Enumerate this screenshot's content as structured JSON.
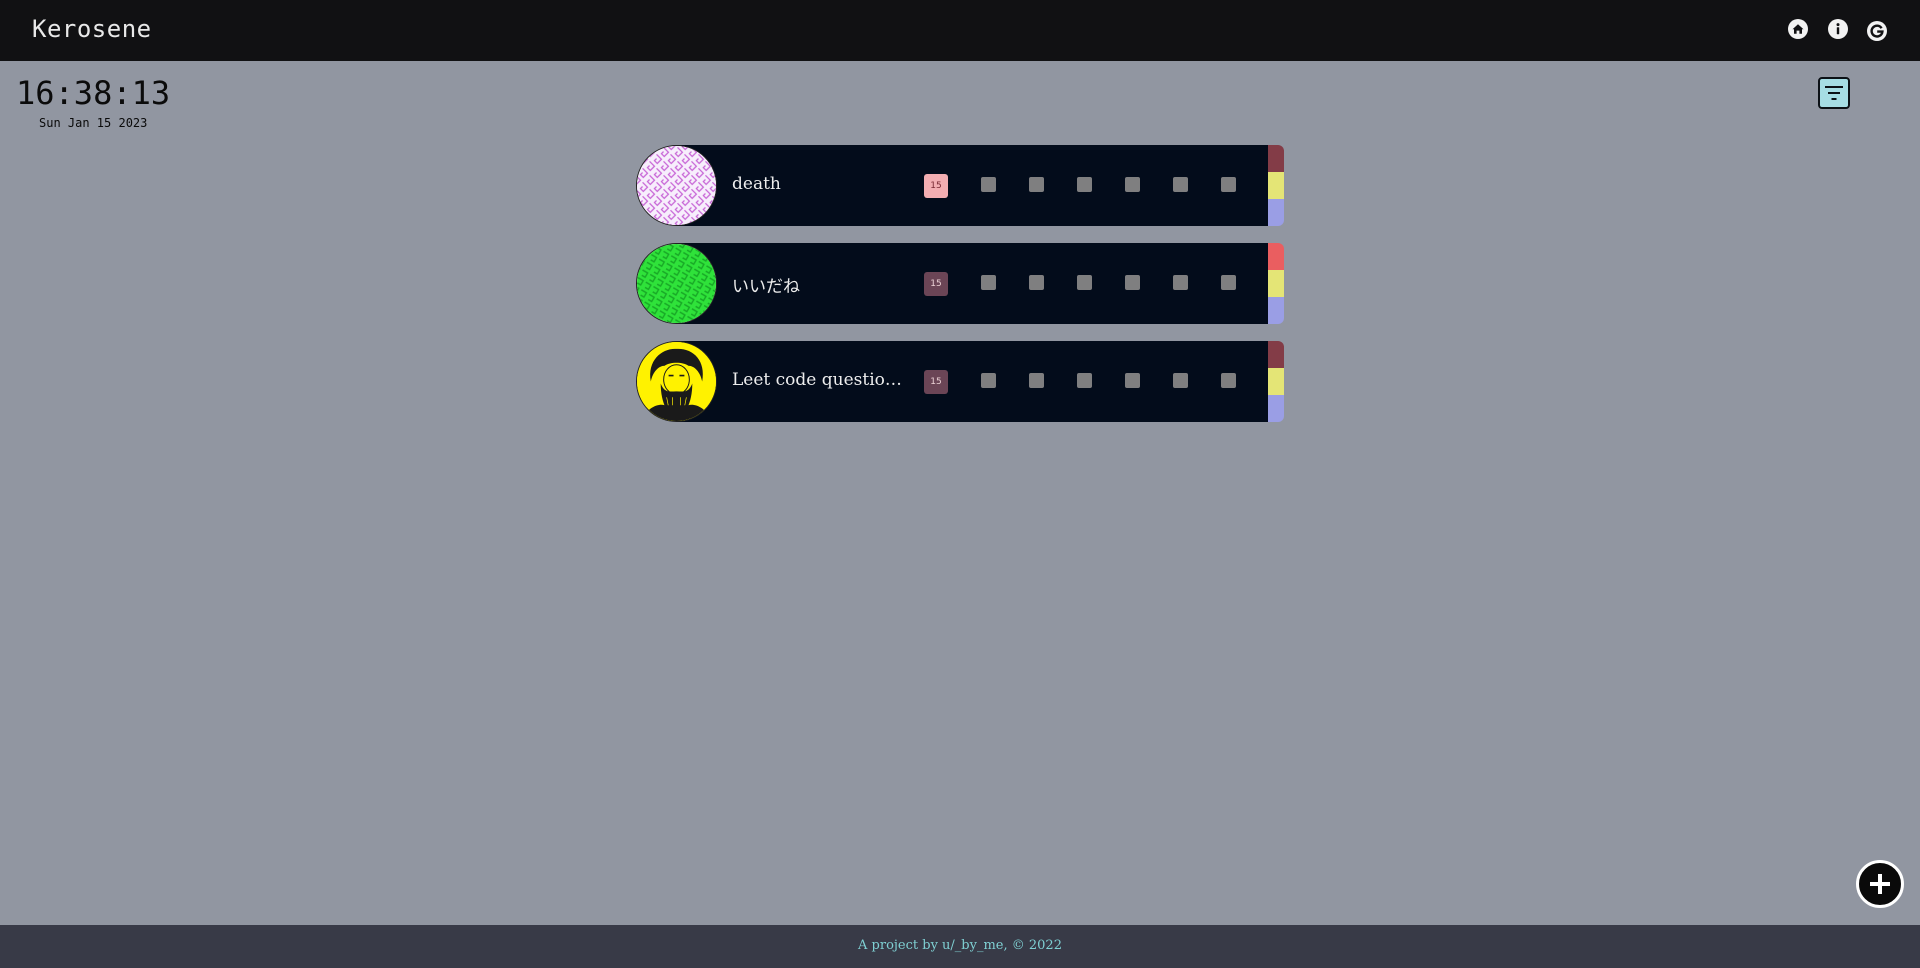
{
  "app": {
    "title": "Kerosene"
  },
  "nav": {
    "icons": [
      "home-icon",
      "info-icon",
      "google-icon"
    ]
  },
  "clock": {
    "time": "16:38:13",
    "date": "Sun Jan 15 2023"
  },
  "filter": {
    "icon": "filter-icon"
  },
  "habits": [
    {
      "name": "death",
      "day": "15",
      "day_badge_bg": "#f3aeb2",
      "day_badge_fg": "#7a2a34",
      "avatar": "pink-pattern",
      "strip_colors": [
        "#833c47",
        "#e4e576",
        "#9a9ee5"
      ]
    },
    {
      "name": "いいだね",
      "day": "15",
      "day_badge_bg": "#6b4556",
      "day_badge_fg": "#ecd2d6",
      "avatar": "green-pattern",
      "strip_colors": [
        "#ea5e60",
        "#e4e576",
        "#9a9ee5"
      ]
    },
    {
      "name": "Leet code questio…",
      "day": "15",
      "day_badge_bg": "#6b4556",
      "day_badge_fg": "#ecd2d6",
      "avatar": "portrait-yellow",
      "strip_colors": [
        "#833c47",
        "#e4e576",
        "#9a9ee5"
      ]
    }
  ],
  "add_button": {
    "icon": "plus-icon"
  },
  "footer": {
    "text": "A project by u/_by_me, © 2022"
  },
  "colors": {
    "background": "#9196a1",
    "topbar": "#111113",
    "row": "#030c1b",
    "footer": "#383a47",
    "footer_text": "#7fd0d3",
    "filter_button": "#a6dde4"
  }
}
